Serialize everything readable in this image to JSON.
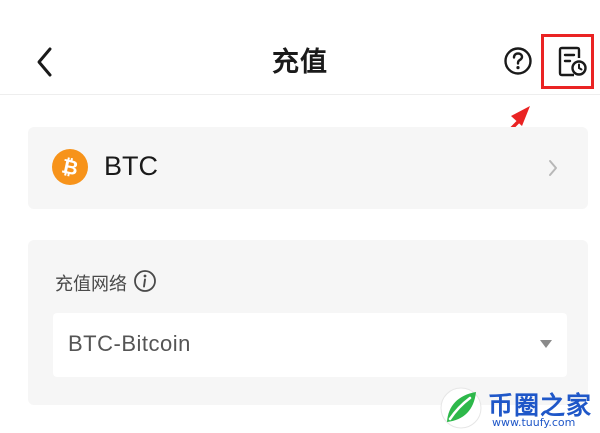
{
  "header": {
    "title": "充值",
    "back_icon": "chevron-left-icon",
    "help_icon": "question-circle-icon",
    "history_icon": "record-clock-icon"
  },
  "coin": {
    "name": "BTC",
    "icon": "bitcoin-icon",
    "icon_color": "#f7931a"
  },
  "network": {
    "label": "充值网络",
    "info_icon": "info-circle-icon",
    "selected": "BTC-Bitcoin"
  },
  "annotation": {
    "color": "#ea2323"
  },
  "watermark": {
    "name": "币圈之家",
    "url": "www.tuufy.com"
  }
}
